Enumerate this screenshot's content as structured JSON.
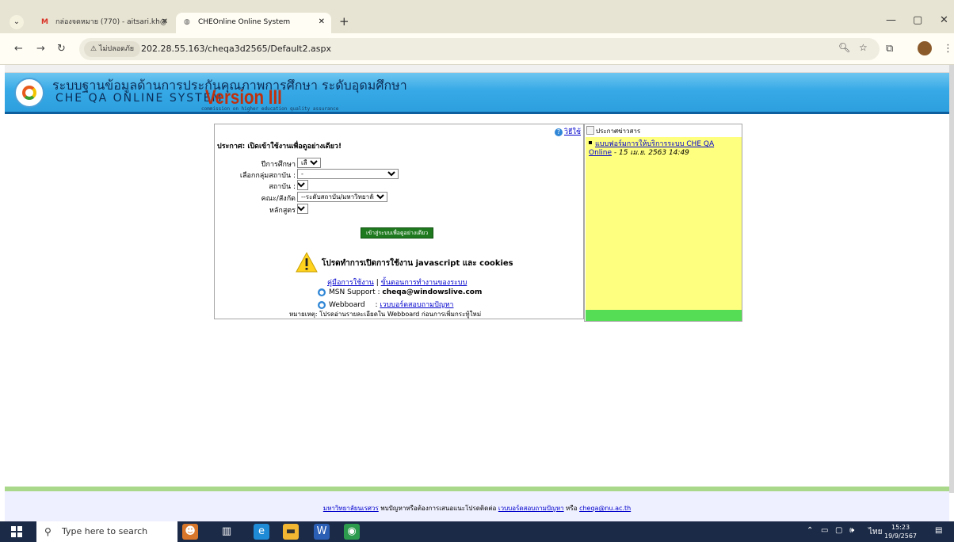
{
  "browser": {
    "tabs": [
      {
        "label": "กล่องจดหมาย (770) - aitsari.kh@",
        "icon": "gmail-icon"
      },
      {
        "label": "CHEOnline Online System",
        "icon": "globe-icon"
      }
    ],
    "security_label": "ไม่ปลอดภัย",
    "url": "202.28.55.163/cheqa3d2565/Default2.aspx"
  },
  "banner": {
    "thai_title": "ระบบฐานข้อมูลด้านการประกันคุณภาพการศึกษา ระดับอุดมศึกษา",
    "en_title": "CHE QA ONLINE SYSTEM",
    "version": "Version III",
    "subtitle": "commission on higher education quality assurance"
  },
  "login": {
    "howto_link": "วิธีใช้",
    "announcement": "ประกาศ: เปิดเข้าใช้งานเพื่อดูอย่างเดียว!",
    "fields": [
      {
        "label": "ปีการศึกษา",
        "value": "เลือกปี"
      },
      {
        "label": "เลือกกลุ่มสถาบัน :",
        "value": "-"
      },
      {
        "label": "สถาบัน :",
        "value": ""
      },
      {
        "label": "คณะ/สังกัด",
        "value": "--ระดับสถาบัน/มหาวิทยาลัย--"
      },
      {
        "label": "หลักสูตร",
        "value": ""
      }
    ],
    "enter_button": "เข้าสู่ระบบเพื่อดูอย่างเดียว",
    "warning": "โปรดทำการเปิดการใช้งาน javascript และ cookies",
    "manual_link": "คู่มือการใช้งาน",
    "separator": "|",
    "steps_link": "ขั้นตอนการทำงานของระบบ",
    "msn_label": "MSN Support :",
    "msn_value": "cheqa@windowslive.com",
    "webboard_label": "Webboard",
    "webboard_colon": ":",
    "webboard_link": "เวบบอร์ดสอบถามปัญหา",
    "note": "หมายเหตุ: โปรดอ่านรายละเอียดใน Webboard ก่อนการเพิ่มกระทู้ใหม่"
  },
  "news": {
    "header": "ประกาศข่าวสาร",
    "item_link": "แบบฟอร์มการให้บริการระบบ CHE QA Online",
    "item_date": "- 15 เม.ย. 2563 14:49",
    "colors": {
      "body": "#ffff7f",
      "footer": "#55dd55"
    }
  },
  "footer": {
    "university_link": "มหาวิทยาลัยนเรศวร",
    "text_middle": "พบปัญหาหรือต้องการเสนอแนะโปรดติดต่อ",
    "webboard_link": "เวบบอร์ดสอบถามปัญหา",
    "or_text": "หรือ",
    "email_link": "cheqa@nu.ac.th"
  },
  "taskbar": {
    "search_placeholder": "Type here to search",
    "language": "ไทย",
    "time": "15:23",
    "date": "19/9/2567"
  }
}
